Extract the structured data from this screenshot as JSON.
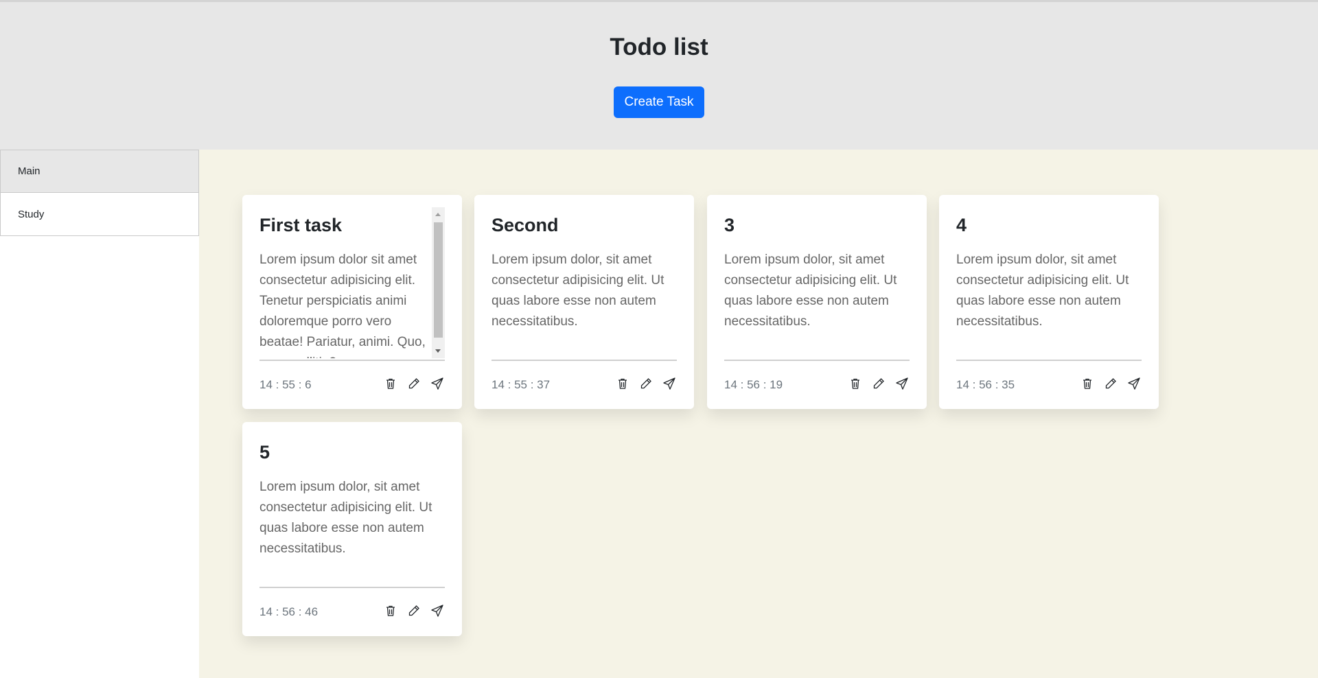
{
  "header": {
    "title": "Todo list",
    "create_button_label": "Create Task"
  },
  "sidebar": {
    "items": [
      {
        "label": "Main",
        "active": true
      },
      {
        "label": "Study",
        "active": false
      }
    ]
  },
  "cards": [
    {
      "title": "First task",
      "text": "Lorem ipsum dolor sit amet consectetur adipisicing elit. Tenetur perspiciatis animi doloremque porro vero beatae! Pariatur, animi. Quo, eum mollitia?",
      "time": "14 : 55 : 6",
      "scrollable": true
    },
    {
      "title": "Second",
      "text": "Lorem ipsum dolor, sit amet consectetur adipisicing elit. Ut quas labore esse non autem necessitatibus.",
      "time": "14 : 55 : 37"
    },
    {
      "title": "3",
      "text": "Lorem ipsum dolor, sit amet consectetur adipisicing elit. Ut quas labore esse non autem necessitatibus.",
      "time": "14 : 56 : 19"
    },
    {
      "title": "4",
      "text": "Lorem ipsum dolor, sit amet consectetur adipisicing elit. Ut quas labore esse non autem necessitatibus.",
      "time": "14 : 56 : 35"
    },
    {
      "title": "5",
      "text": "Lorem ipsum dolor, sit amet consectetur adipisicing elit. Ut quas labore esse non autem necessitatibus.",
      "time": "14 : 56 : 46"
    }
  ],
  "card_action_icons": [
    "trash-icon",
    "pencil-icon",
    "send-icon"
  ],
  "colors": {
    "accent": "#0d6efd",
    "header_bg": "#e7e7e7",
    "main_bg": "#f5f3e6"
  }
}
